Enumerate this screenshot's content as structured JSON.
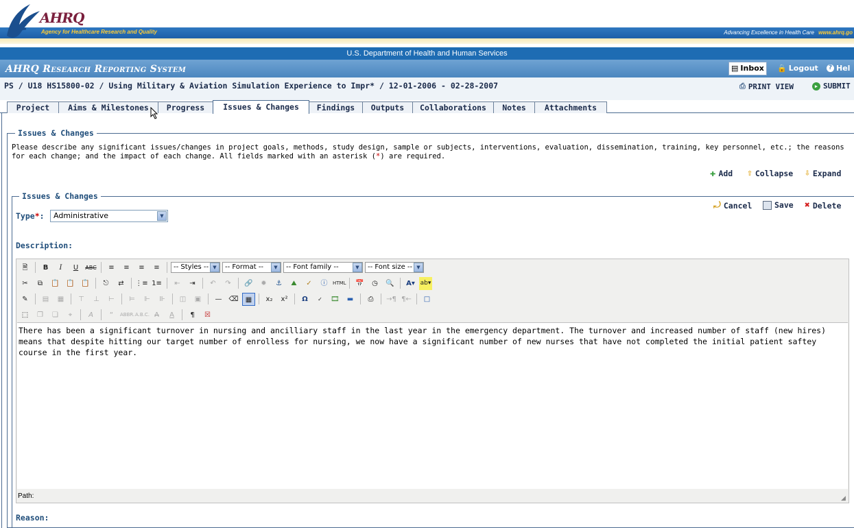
{
  "header": {
    "logo_text": "AHRQ",
    "agency_name": "Agency for Healthcare Research and Quality",
    "tagline": "Advancing Excellence in Health Care",
    "site_url": "www.ahrq.go",
    "department": "U.S. Department of Health and Human Services",
    "system_title": "AHRQ Research Reporting System",
    "inbox_label": "Inbox",
    "logout_label": "Logout",
    "help_label": "Hel"
  },
  "project": {
    "breadcrumb": "PS / U18 HS15800-02 / Using Military & Aviation Simulation Experience to Impr* / 12-01-2006 - 02-28-2007",
    "print_view_label": "PRINT VIEW",
    "submit_label": "SUBMIT"
  },
  "tabs": [
    {
      "label": "Project",
      "width": 76
    },
    {
      "label": "Aims & Milestones",
      "width": 146
    },
    {
      "label": "Progress",
      "width": 81
    },
    {
      "label": "Issues & Changes",
      "width": 141,
      "active": true
    },
    {
      "label": "Findings",
      "width": 79
    },
    {
      "label": "Outputs",
      "width": 74
    },
    {
      "label": "Collaborations",
      "width": 119
    },
    {
      "label": "Notes",
      "width": 61
    },
    {
      "label": "Attachments",
      "width": 106
    }
  ],
  "section": {
    "legend": "Issues & Changes",
    "instructions_pre": "Please describe any significant issues/changes in project goals, methods, study design, sample or subjects, interventions, evaluation, dissemination, training, key personnel, etc.; the reasons for each change; and the impact of each change. All fields marked with an asterisk (",
    "asterisk": "*",
    "instructions_post": ") are required.",
    "add_label": "Add",
    "collapse_label": "Collapse",
    "expand_label": "Expand"
  },
  "entry": {
    "legend": "Issues & Changes",
    "cancel_label": "Cancel",
    "save_label": "Save",
    "delete_label": "Delete",
    "type_label": "Type",
    "type_value": "Administrative",
    "description_label": "Description:",
    "reason_label": "Reason:"
  },
  "editor": {
    "styles_select": "-- Styles --",
    "format_select": "-- Format --",
    "font_family_select": "-- Font family --",
    "font_size_select": "-- Font size --",
    "content": "There has been a significant turnover in nursing and ancilliary staff in the last year in the emergency department.  The turnover and increased number of staff (new hires) means that despite hitting our target number of enrolless for nursing, we now have a significant number of new nurses that have not completed the initial patient saftey course in the first year.",
    "path_label": "Path:"
  },
  "colors": {
    "banner_blue": "#1e6cb3",
    "system_bar": "#4b86bf",
    "label_blue": "#1f4d7a",
    "required_red": "#cc0000"
  }
}
